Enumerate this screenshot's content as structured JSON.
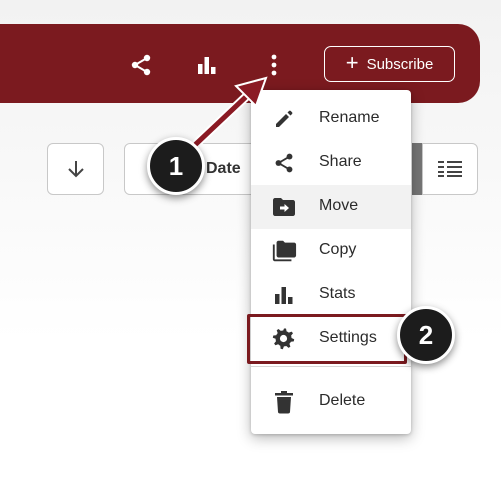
{
  "header": {
    "share_icon": "share-icon",
    "stats_icon": "bar-chart-icon",
    "more_icon": "more-vertical-icon",
    "subscribe_label": "Subscribe",
    "subscribe_icon": "plus-icon",
    "color": "#7b1a1f"
  },
  "toolbar": {
    "sort_direction_icon": "arrow-down-icon",
    "sort_label": "Date",
    "view_icon": "list-view-icon"
  },
  "menu": {
    "items": [
      {
        "label": "Rename",
        "icon": "pencil-icon"
      },
      {
        "label": "Share",
        "icon": "share-icon"
      },
      {
        "label": "Move",
        "icon": "folder-move-icon"
      },
      {
        "label": "Copy",
        "icon": "copy-folder-icon"
      },
      {
        "label": "Stats",
        "icon": "bar-chart-icon"
      },
      {
        "label": "Settings",
        "icon": "gear-icon"
      },
      {
        "label": "Delete",
        "icon": "trash-icon"
      }
    ]
  },
  "annotations": {
    "step1": "1",
    "step2": "2",
    "highlight_color": "#7b1a1f",
    "arrow_color": "#8b1a24"
  }
}
